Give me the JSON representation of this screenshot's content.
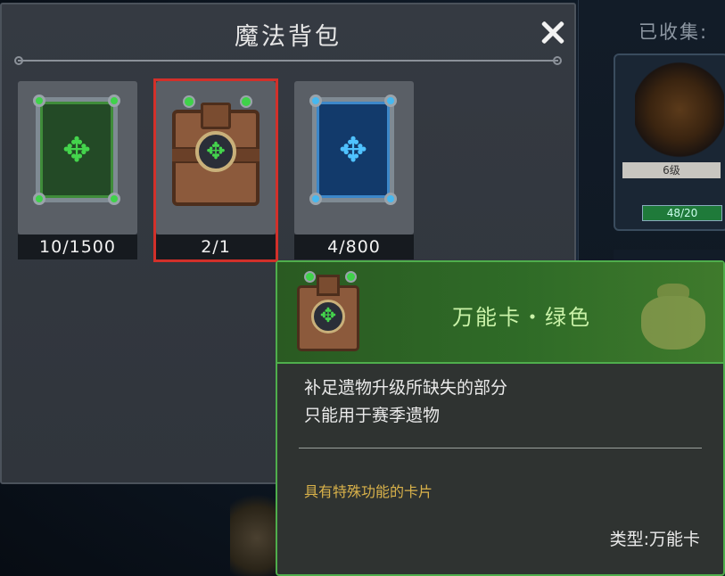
{
  "background": {
    "collected_label": "已收集:",
    "card_level": "6级",
    "card_progress": "48/20"
  },
  "bag": {
    "title": "魔法背包",
    "close_icon": "close-icon",
    "slots": [
      {
        "kind": "green-card",
        "count": "10/1500",
        "selected": false
      },
      {
        "kind": "wildcard-book",
        "count": "2/1",
        "selected": true
      },
      {
        "kind": "blue-card",
        "count": "4/800",
        "selected": false
      }
    ]
  },
  "tooltip": {
    "title": "万能卡・绿色",
    "description_line1": "补足遗物升级所缺失的部分",
    "description_line2": "只能用于赛季遗物",
    "feature": "具有特殊功能的卡片",
    "type": "类型:万能卡",
    "accent_color": "#4fae4c",
    "title_color": "#caf2a8",
    "feature_color": "#d9b24a"
  },
  "colors": {
    "selected_outline": "#d2302a",
    "panel_bg": "#353a42"
  }
}
